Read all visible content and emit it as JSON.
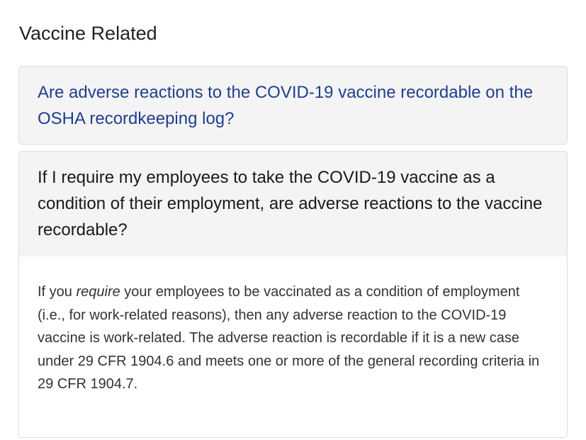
{
  "section": {
    "title": "Vaccine Related"
  },
  "faqs": [
    {
      "question": "Are adverse reactions to the COVID-19 vaccine recordable on the OSHA recordkeeping log?",
      "expanded": false
    },
    {
      "question": "If I require my employees to take the COVID-19 vaccine as a condition of their employment, are adverse reactions to the vaccine recordable?",
      "expanded": true,
      "answer": {
        "before": "If you ",
        "emphasis": "require",
        "after": " your employees to be vaccinated as a condition of employment (i.e., for work-related reasons), then any adverse reaction to the COVID-19 vaccine is work-related. The adverse reaction is recordable if it is a new case under 29 CFR 1904.6 and meets one or more of the general recording criteria in 29 CFR 1904.7."
      }
    }
  ],
  "colors": {
    "link": "#1f3f8f",
    "panel_header": "#f4f4f4",
    "border": "#dcdcdc"
  }
}
